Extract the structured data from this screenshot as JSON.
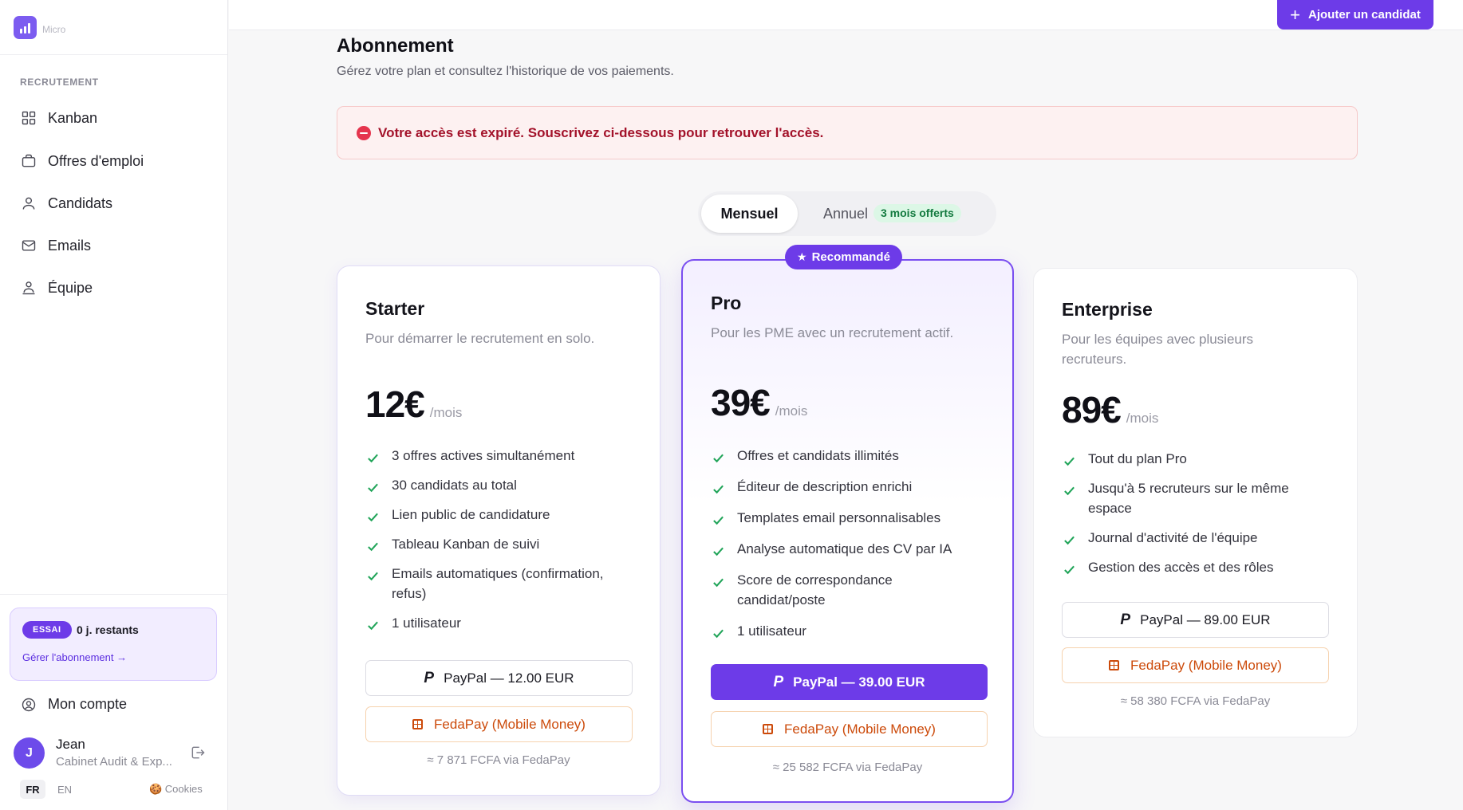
{
  "brand": {
    "name": "Micro",
    "color": "#7c5cf0"
  },
  "sidebar": {
    "section_label": "RECRUTEMENT",
    "items": [
      {
        "label": "Kanban",
        "icon": "grid-icon"
      },
      {
        "label": "Offres d'emploi",
        "icon": "briefcase-icon"
      },
      {
        "label": "Candidats",
        "icon": "user-icon"
      },
      {
        "label": "Emails",
        "icon": "mail-icon"
      },
      {
        "label": "Équipe",
        "icon": "team-icon"
      }
    ],
    "trial": {
      "badge": "ESSAI",
      "remaining": "0 j. restants",
      "link": "Gérer l'abonnement →"
    },
    "account_label": "Mon compte",
    "user": {
      "initial": "J",
      "name": "Jean",
      "company": "Cabinet Audit & Exp..."
    },
    "languages": {
      "active": "FR",
      "other": "EN"
    },
    "cookies": "🍪 Cookies"
  },
  "header": {
    "add_candidate_label": "Ajouter un candidat"
  },
  "page": {
    "title": "Abonnement",
    "subtitle": "Gérez votre plan et consultez l'historique de vos paiements.",
    "alert": "Votre accès est expiré. Souscrivez ci-dessous pour retrouver l'accès."
  },
  "billing_toggle": {
    "monthly": "Mensuel",
    "annual": "Annuel",
    "annual_offer": "3 mois offerts",
    "selected": "Mensuel"
  },
  "plans": {
    "starter": {
      "name": "Starter",
      "description": "Pour démarrer le recrutement en solo.",
      "price": "12€",
      "period": "/mois",
      "features": [
        "3 offres actives simultanément",
        "30 candidats au total",
        "Lien public de candidature",
        "Tableau Kanban de suivi",
        "Emails automatiques (confirmation, refus)",
        "1 utilisateur"
      ],
      "paypal": "PayPal — 12.00 EUR",
      "fedapay": "FedaPay (Mobile Money)",
      "fcfa": "≈ 7 871 FCFA via FedaPay"
    },
    "pro": {
      "badge": "Recommandé",
      "name": "Pro",
      "description": "Pour les PME avec un recrutement actif.",
      "price": "39€",
      "period": "/mois",
      "features": [
        "Offres et candidats illimités",
        "Éditeur de description enrichi",
        "Templates email personnalisables",
        "Analyse automatique des CV par IA",
        "Score de correspondance candidat/poste",
        "1 utilisateur"
      ],
      "paypal": "PayPal — 39.00 EUR",
      "fedapay": "FedaPay (Mobile Money)",
      "fcfa": "≈ 25 582 FCFA via FedaPay"
    },
    "enterprise": {
      "name": "Enterprise",
      "description": "Pour les équipes avec plusieurs recruteurs.",
      "price": "89€",
      "period": "/mois",
      "features": [
        "Tout du plan Pro",
        "Jusqu'à 5 recruteurs sur le même espace",
        "Journal d'activité de l'équipe",
        "Gestion des accès et des rôles"
      ],
      "paypal": "PayPal — 89.00 EUR",
      "fedapay": "FedaPay (Mobile Money)",
      "fcfa": "≈ 58 380 FCFA via FedaPay"
    }
  },
  "colors": {
    "accent": "#6d3be8",
    "success": "#22a55a",
    "danger": "#e5344d",
    "fedapay": "#cc4a0a"
  }
}
